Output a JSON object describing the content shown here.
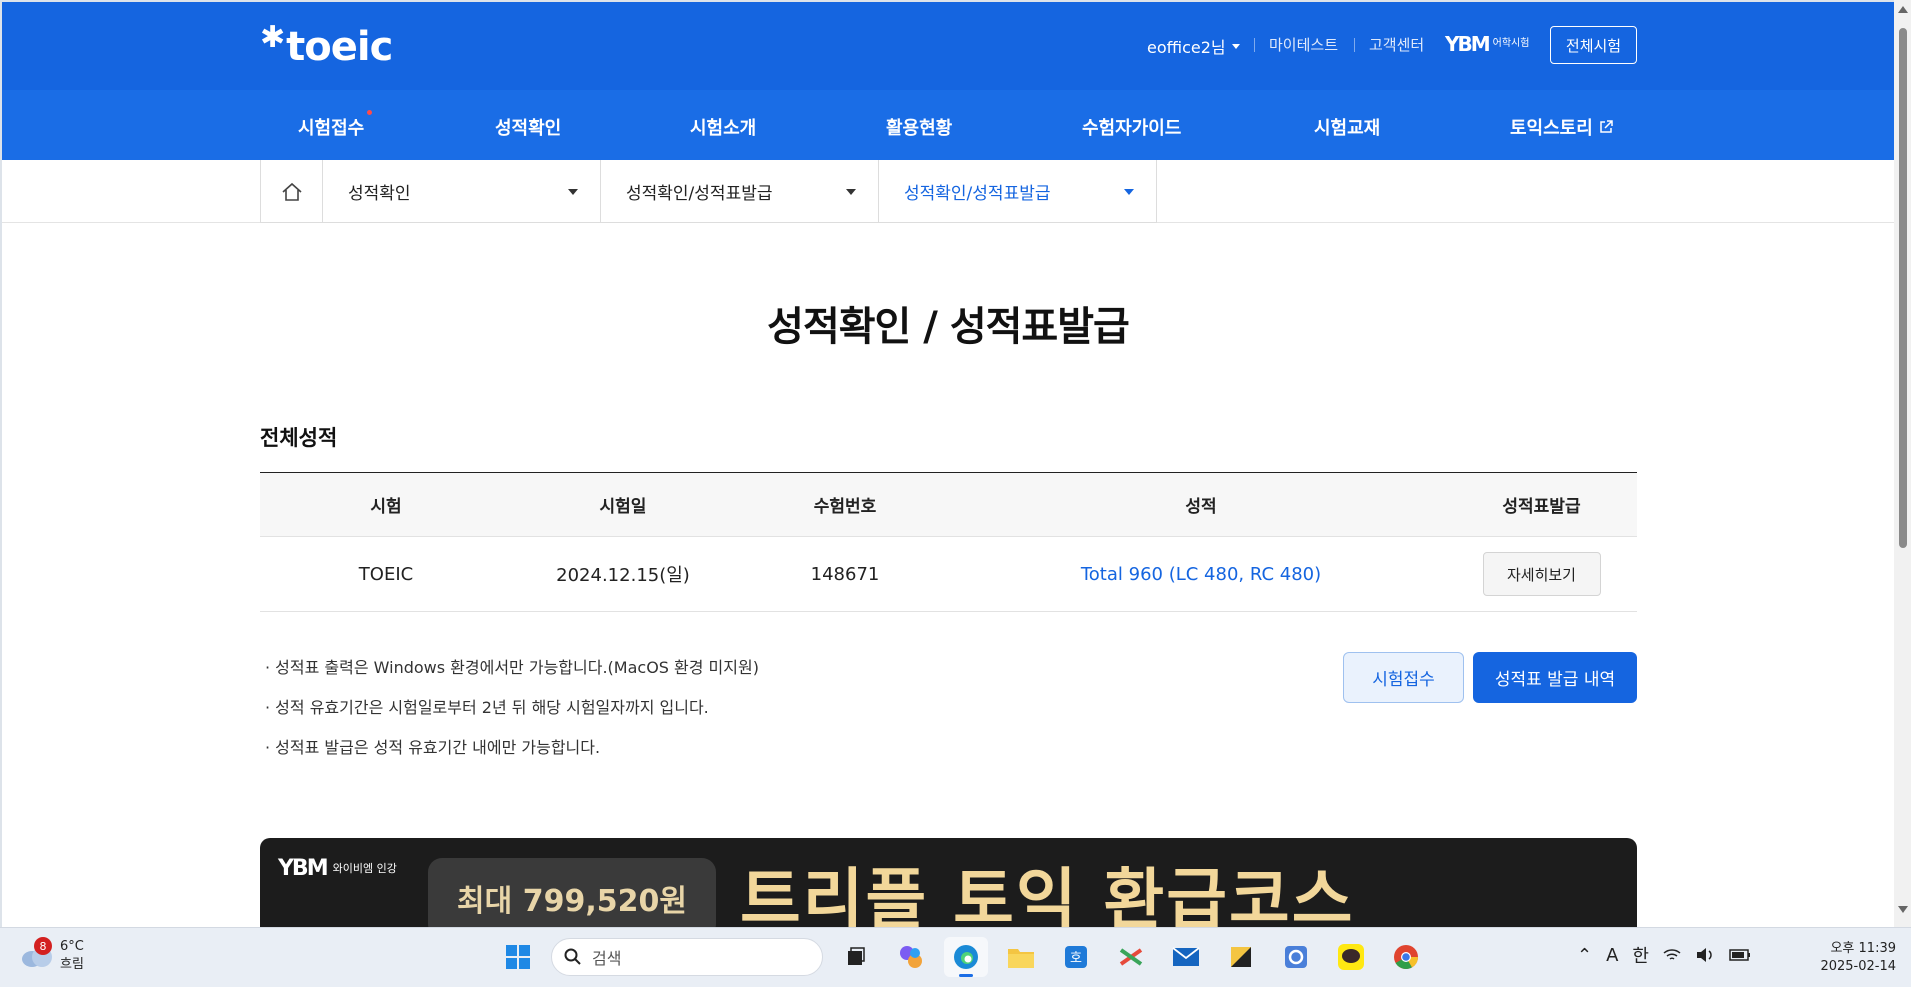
{
  "header": {
    "logo": "toeic",
    "user": "eoffice2님",
    "links": [
      "마이테스트",
      "고객센터"
    ],
    "ybm_brand": "YBM",
    "ybm_sub": "어학시험",
    "all_tests_button": "전체시험"
  },
  "gnb": {
    "items": [
      "시험접수",
      "성적확인",
      "시험소개",
      "활용현황",
      "수험자가이드",
      "시험교재",
      "토익스토리"
    ]
  },
  "breadcrumb": {
    "level1": "성적확인",
    "level2": "성적확인/성적표발급",
    "level3": "성적확인/성적표발급"
  },
  "page": {
    "title": "성적확인 / 성적표발급",
    "section_title": "전체성적"
  },
  "table": {
    "headers": [
      "시험",
      "시험일",
      "수험번호",
      "성적",
      "성적표발급"
    ],
    "rows": [
      {
        "exam": "TOEIC",
        "date": "2024.12.15(일)",
        "number": "148671",
        "score": "Total 960 (LC 480, RC 480)",
        "action": "자세히보기"
      }
    ]
  },
  "notes": [
    "· 성적표 출력은 Windows 환경에서만 가능합니다.(MacOS 환경 미지원)",
    "· 성적 유효기간은 시험일로부터 2년 뒤 해당 시험일자까지 입니다.",
    "· 성적표 발급은 성적 유효기간 내에만 가능합니다."
  ],
  "buttons": {
    "register": "시험접수",
    "history": "성적표 발급 내역"
  },
  "banner": {
    "brand": "YBM",
    "brand_sub": "와이비엠 인강",
    "badge": "최대 799,520원",
    "headline": "트리플 토익 환급코스"
  },
  "taskbar": {
    "weather_badge": "8",
    "temperature": "6°C",
    "condition": "흐림",
    "search_placeholder": "검색",
    "ime_a": "A",
    "ime_lang": "한",
    "time": "오후 11:39",
    "date": "2025-02-14"
  },
  "colors": {
    "brand_blue": "#1565e0",
    "gnb_blue": "#1a6de6"
  }
}
